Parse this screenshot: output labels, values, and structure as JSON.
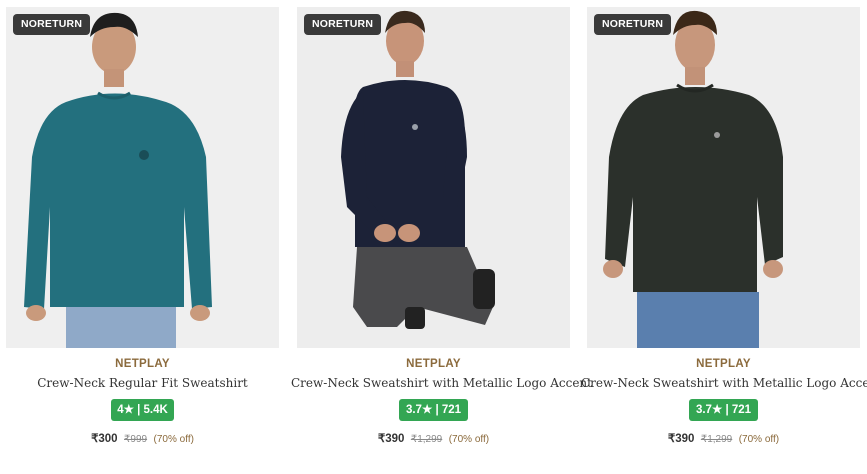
{
  "products": [
    {
      "badge": "NORETURN",
      "brand": "NETPLAY",
      "name": "Crew-Neck Regular Fit Sweatshirt",
      "rating": "4★ | 5.4K",
      "price": "₹300",
      "mrp": "₹999",
      "discount": "(70% off)",
      "image": {
        "description_color_top": "#23707e",
        "pants_color": "#8fa9c8",
        "bg": "#efefef"
      }
    },
    {
      "badge": "NORETURN",
      "brand": "NETPLAY",
      "name": "Crew-Neck Sweatshirt with Metallic Logo Accent",
      "rating": "3.7★ | 721",
      "price": "₹390",
      "mrp": "₹1,299",
      "discount": "(70% off)",
      "image": {
        "description_color_top": "#1c2237",
        "pants_color": "#4a4a4c",
        "bg": "#ededed"
      }
    },
    {
      "badge": "NORETURN",
      "brand": "NETPLAY",
      "name": "Crew-Neck Sweatshirt with Metallic Logo Accent",
      "rating": "3.7★ | 721",
      "price": "₹390",
      "mrp": "₹1,299",
      "discount": "(70% off)",
      "image": {
        "description_color_top": "#2b302b",
        "pants_color": "#5a7fae",
        "bg": "#eeeeee"
      }
    }
  ],
  "colors": {
    "brand_text": "#8b6a3c",
    "rating_bg": "#33a653",
    "badge_bg": "#3a3a3a"
  }
}
